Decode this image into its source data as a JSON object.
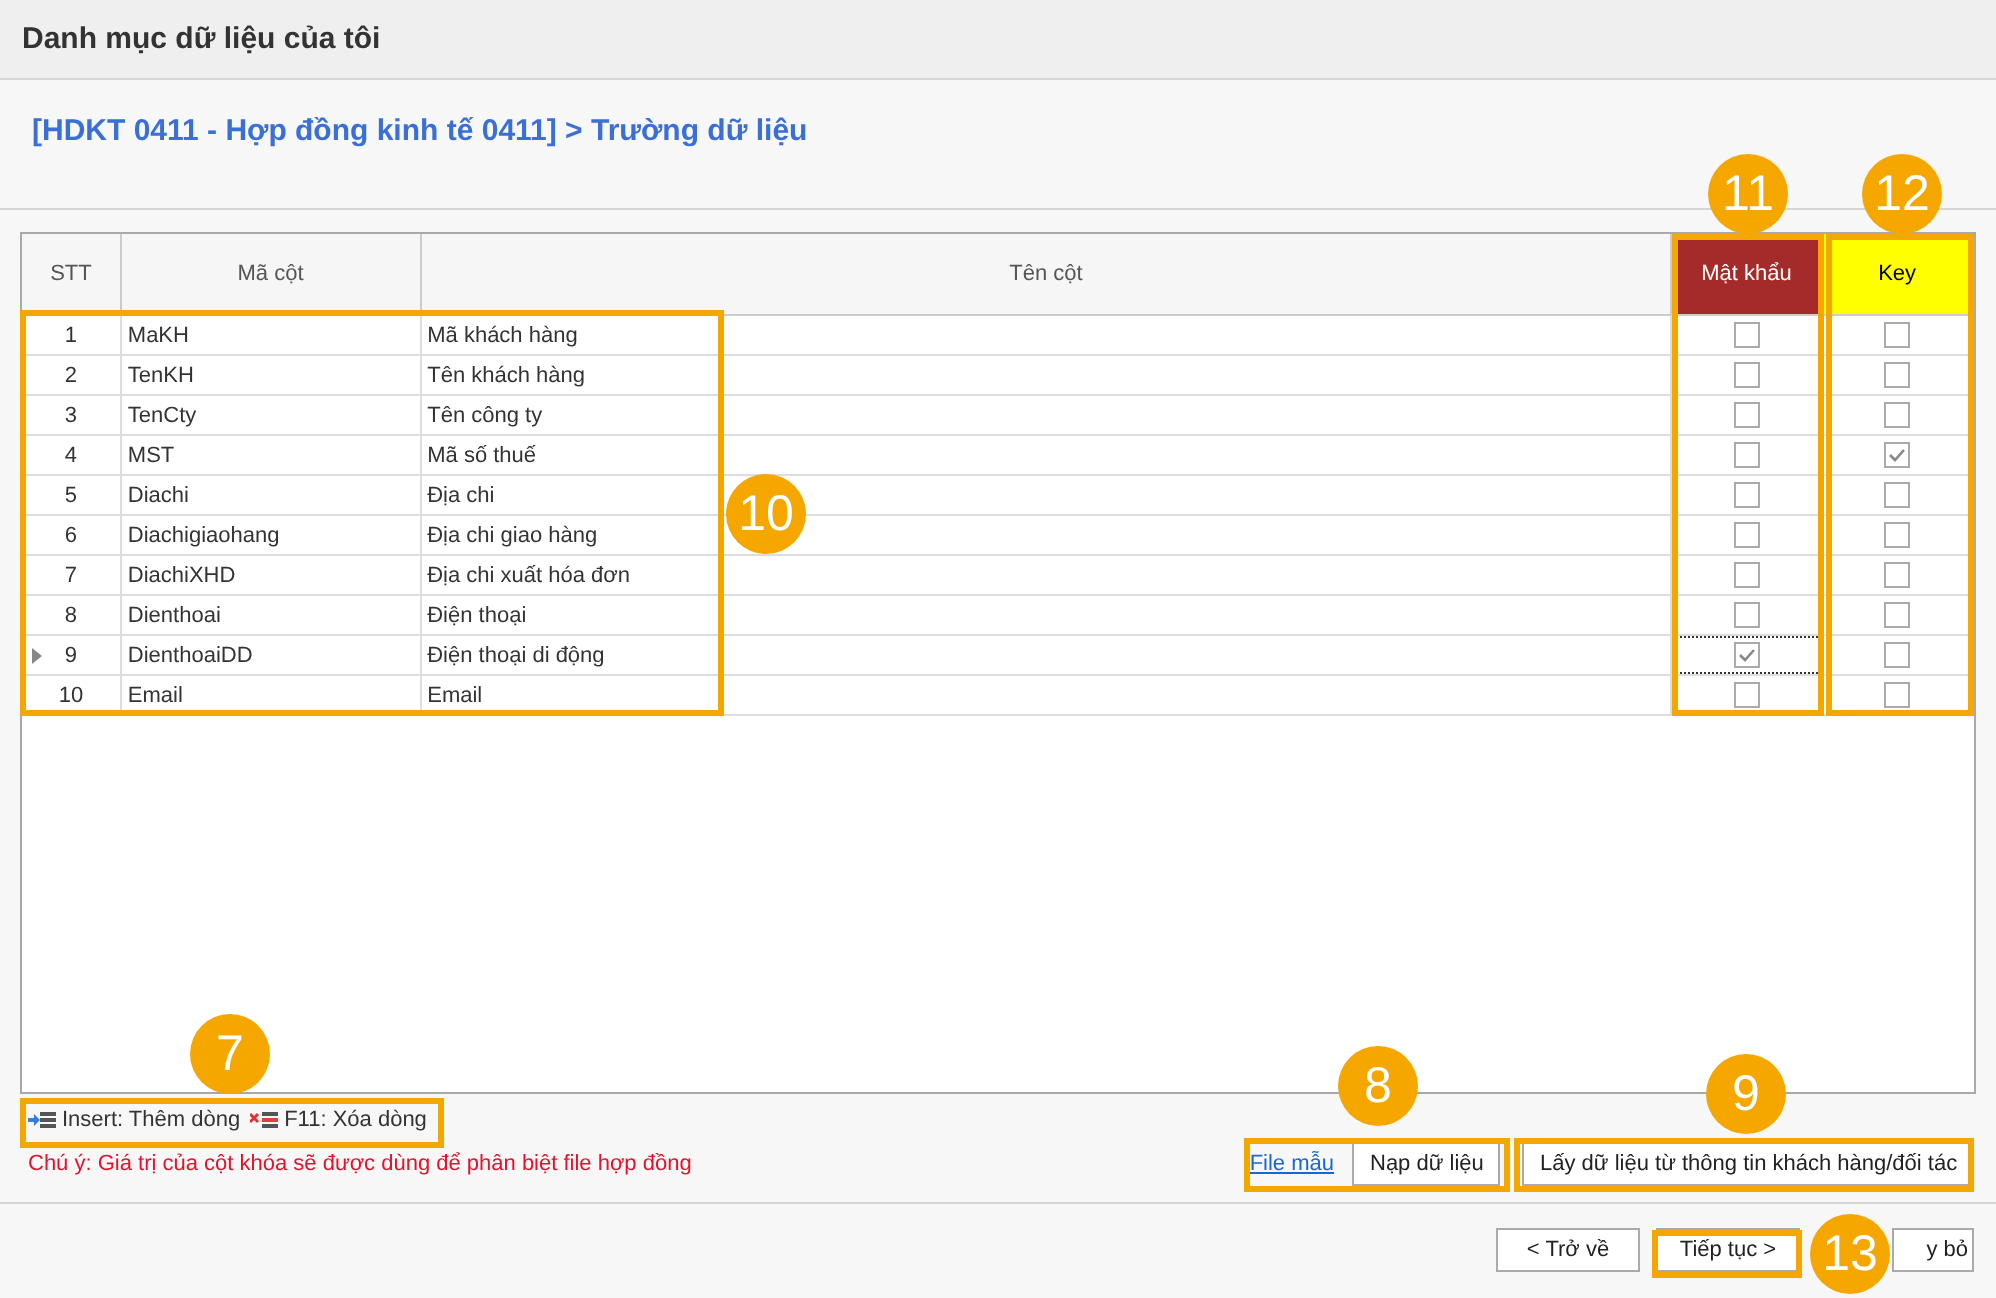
{
  "window": {
    "title": "Danh mục dữ liệu của tôi"
  },
  "breadcrumb": "[HDKT 0411 - Hợp đồng kinh tế 0411] > Trường dữ liệu",
  "table": {
    "columns": [
      {
        "label": "STT",
        "kind": "text"
      },
      {
        "label": "Mã cột",
        "kind": "text"
      },
      {
        "label": "Tên cột",
        "kind": "text"
      },
      {
        "label": "Mật khẩu",
        "kind": "check",
        "color": "#a52a2a"
      },
      {
        "label": "Key",
        "kind": "check",
        "color": "#ffff00"
      }
    ],
    "rows": [
      {
        "stt": "1",
        "code": "MaKH",
        "name": "Mã khách hàng",
        "password": false,
        "key": false,
        "selected": false
      },
      {
        "stt": "2",
        "code": "TenKH",
        "name": "Tên khách hàng",
        "password": false,
        "key": false,
        "selected": false
      },
      {
        "stt": "3",
        "code": "TenCty",
        "name": "Tên công ty",
        "password": false,
        "key": false,
        "selected": false
      },
      {
        "stt": "4",
        "code": "MST",
        "name": "Mã số thuế",
        "password": false,
        "key": true,
        "selected": false
      },
      {
        "stt": "5",
        "code": "Diachi",
        "name": "Địa chi",
        "password": false,
        "key": false,
        "selected": false
      },
      {
        "stt": "6",
        "code": "Diachigiaohang",
        "name": "Địa chi giao hàng",
        "password": false,
        "key": false,
        "selected": false
      },
      {
        "stt": "7",
        "code": "DiachiXHD",
        "name": "Địa chi xuất hóa đơn",
        "password": false,
        "key": false,
        "selected": false
      },
      {
        "stt": "8",
        "code": "Dienthoai",
        "name": "Điện thoại",
        "password": false,
        "key": false,
        "selected": false
      },
      {
        "stt": "9",
        "code": "DienthoaiDD",
        "name": "Điện thoại di động",
        "password": true,
        "key": false,
        "selected": true
      },
      {
        "stt": "10",
        "code": "Email",
        "name": "Email",
        "password": false,
        "key": false,
        "selected": false
      }
    ]
  },
  "shortcuts": [
    {
      "label": "Insert: Thêm dòng",
      "kind": "add"
    },
    {
      "label": "F11: Xóa dòng",
      "kind": "delete"
    }
  ],
  "note": "Chú ý: Giá trị của cột khóa sẽ được dùng để phân biệt file hợp đồng",
  "template_link": "File mẫu",
  "load_button": "Nạp dữ liệu",
  "fetch_button": "Lấy dữ liệu từ thông tin khách hàng/đối tác",
  "footer_buttons": [
    "< Trở về",
    "Tiếp tục >",
    "y bỏ"
  ],
  "callouts": [
    {
      "number": "7"
    },
    {
      "number": "8"
    },
    {
      "number": "9"
    },
    {
      "number": "10"
    },
    {
      "number": "11"
    },
    {
      "number": "12"
    },
    {
      "number": "13"
    }
  ]
}
